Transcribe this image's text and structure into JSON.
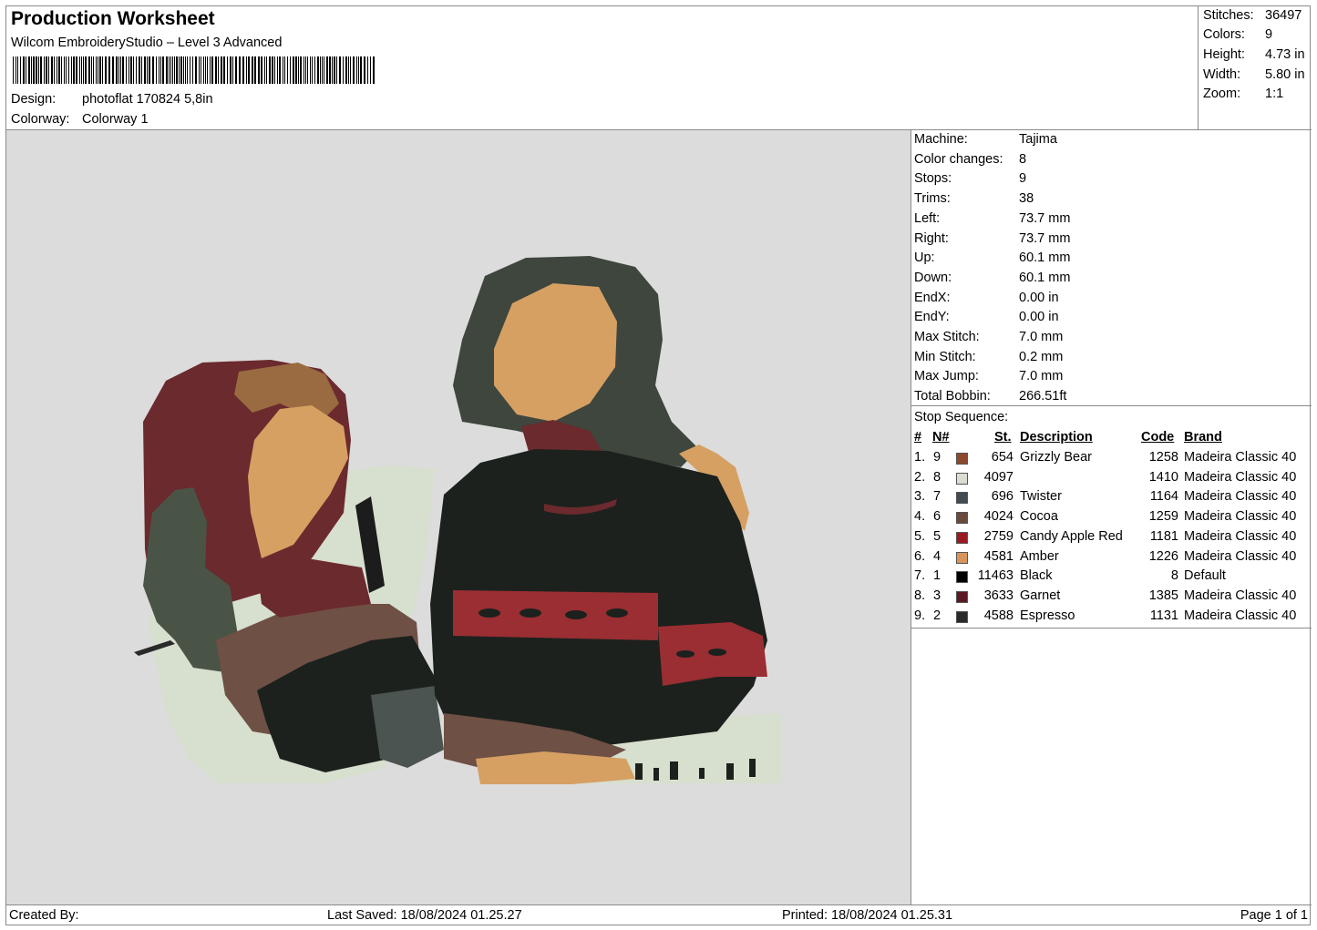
{
  "header": {
    "title": "Production Worksheet",
    "software": "Wilcom EmbroideryStudio – Level 3 Advanced",
    "design_label": "Design:",
    "design_value": "photoflat 170824 5,8in",
    "colorway_label": "Colorway:",
    "colorway_value": "Colorway 1"
  },
  "summary": {
    "stitches_label": "Stitches:",
    "stitches": "36497",
    "colors_label": "Colors:",
    "colors": "9",
    "height_label": "Height:",
    "height": "4.73 in",
    "width_label": "Width:",
    "width": "5.80 in",
    "zoom_label": "Zoom:",
    "zoom": "1:1"
  },
  "machine": [
    {
      "label": "Machine:",
      "value": "Tajima"
    },
    {
      "label": "Color changes:",
      "value": "8"
    },
    {
      "label": "Stops:",
      "value": "9"
    },
    {
      "label": "Trims:",
      "value": "38"
    },
    {
      "label": "Left:",
      "value": "73.7 mm"
    },
    {
      "label": "Right:",
      "value": "73.7 mm"
    },
    {
      "label": "Up:",
      "value": "60.1 mm"
    },
    {
      "label": "Down:",
      "value": "60.1 mm"
    },
    {
      "label": "EndX:",
      "value": "0.00 in"
    },
    {
      "label": "EndY:",
      "value": "0.00 in"
    },
    {
      "label": "Max Stitch:",
      "value": "7.0 mm"
    },
    {
      "label": "Min Stitch:",
      "value": "0.2 mm"
    },
    {
      "label": "Max Jump:",
      "value": "7.0 mm"
    },
    {
      "label": "Total Bobbin:",
      "value": "266.51ft"
    }
  ],
  "stop_sequence": {
    "title": "Stop Sequence:",
    "headers": {
      "num": "#",
      "n": "N#",
      "st": "St.",
      "desc": "Description",
      "code": "Code",
      "brand": "Brand"
    },
    "rows": [
      {
        "num": "1.",
        "n": "9",
        "color": "#8b4a2b",
        "st": "654",
        "desc": "Grizzly Bear",
        "code": "1258",
        "brand": "Madeira Classic 40"
      },
      {
        "num": "2.",
        "n": "8",
        "color": "#dcdcd2",
        "st": "4097",
        "desc": "",
        "code": "1410",
        "brand": "Madeira Classic 40"
      },
      {
        "num": "3.",
        "n": "7",
        "color": "#424a52",
        "st": "696",
        "desc": "Twister",
        "code": "1164",
        "brand": "Madeira Classic 40"
      },
      {
        "num": "4.",
        "n": "6",
        "color": "#6b4a3e",
        "st": "4024",
        "desc": "Cocoa",
        "code": "1259",
        "brand": "Madeira Classic 40"
      },
      {
        "num": "5.",
        "n": "5",
        "color": "#9b1a22",
        "st": "2759",
        "desc": "Candy Apple Red",
        "code": "1181",
        "brand": "Madeira Classic 40"
      },
      {
        "num": "6.",
        "n": "4",
        "color": "#d6955a",
        "st": "4581",
        "desc": "Amber",
        "code": "1226",
        "brand": "Madeira Classic 40"
      },
      {
        "num": "7.",
        "n": "1",
        "color": "#000000",
        "st": "11463",
        "desc": "Black",
        "code": "8",
        "brand": "Default"
      },
      {
        "num": "8.",
        "n": "3",
        "color": "#5a1a24",
        "st": "3633",
        "desc": "Garnet",
        "code": "1385",
        "brand": "Madeira Classic 40"
      },
      {
        "num": "9.",
        "n": "2",
        "color": "#2a2a2a",
        "st": "4588",
        "desc": "Espresso",
        "code": "1131",
        "brand": "Madeira Classic 40"
      }
    ]
  },
  "footer": {
    "created_by": "Created By:",
    "last_saved": "Last Saved: 18/08/2024 01.25.27",
    "printed": "Printed: 18/08/2024 01.25.31",
    "page": "Page 1 of 1"
  },
  "colors": {
    "preview_bg": "#dcdcdc",
    "hair_dark_green": "#3e463d",
    "skin_amber": "#d6a063",
    "maroon": "#6b2a2e",
    "red_stripe": "#9a2e33",
    "black_sweater": "#1c211d",
    "pale_fabric": "#d7dfce",
    "cocoa": "#6e5044",
    "twister": "#4b5450"
  }
}
